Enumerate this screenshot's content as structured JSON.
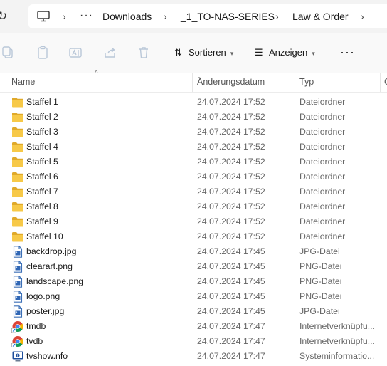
{
  "breadcrumb": {
    "items": [
      "Downloads",
      "_1_TO-NAS-SERIES",
      "Law & Order"
    ],
    "more": "···"
  },
  "toolbar": {
    "sort_label": "Sortieren",
    "view_label": "Anzeigen",
    "more": "···"
  },
  "columns": {
    "name": "Name",
    "date": "Änderungsdatum",
    "type": "Typ",
    "size": "G"
  },
  "files": [
    {
      "name": "Staffel 1",
      "date": "24.07.2024 17:52",
      "type": "Dateiordner",
      "icon": "folder-icon"
    },
    {
      "name": "Staffel 2",
      "date": "24.07.2024 17:52",
      "type": "Dateiordner",
      "icon": "folder-icon"
    },
    {
      "name": "Staffel 3",
      "date": "24.07.2024 17:52",
      "type": "Dateiordner",
      "icon": "folder-icon"
    },
    {
      "name": "Staffel 4",
      "date": "24.07.2024 17:52",
      "type": "Dateiordner",
      "icon": "folder-icon"
    },
    {
      "name": "Staffel 5",
      "date": "24.07.2024 17:52",
      "type": "Dateiordner",
      "icon": "folder-icon"
    },
    {
      "name": "Staffel 6",
      "date": "24.07.2024 17:52",
      "type": "Dateiordner",
      "icon": "folder-icon"
    },
    {
      "name": "Staffel 7",
      "date": "24.07.2024 17:52",
      "type": "Dateiordner",
      "icon": "folder-icon"
    },
    {
      "name": "Staffel 8",
      "date": "24.07.2024 17:52",
      "type": "Dateiordner",
      "icon": "folder-icon"
    },
    {
      "name": "Staffel 9",
      "date": "24.07.2024 17:52",
      "type": "Dateiordner",
      "icon": "folder-icon"
    },
    {
      "name": "Staffel 10",
      "date": "24.07.2024 17:52",
      "type": "Dateiordner",
      "icon": "folder-icon"
    },
    {
      "name": "backdrop.jpg",
      "date": "24.07.2024 17:45",
      "type": "JPG-Datei",
      "icon": "image-file-icon"
    },
    {
      "name": "clearart.png",
      "date": "24.07.2024 17:45",
      "type": "PNG-Datei",
      "icon": "image-file-icon"
    },
    {
      "name": "landscape.png",
      "date": "24.07.2024 17:45",
      "type": "PNG-Datei",
      "icon": "image-file-icon"
    },
    {
      "name": "logo.png",
      "date": "24.07.2024 17:45",
      "type": "PNG-Datei",
      "icon": "image-file-icon"
    },
    {
      "name": "poster.jpg",
      "date": "24.07.2024 17:45",
      "type": "JPG-Datei",
      "icon": "image-file-icon"
    },
    {
      "name": "tmdb",
      "date": "24.07.2024 17:47",
      "type": "Internetverknüpfu...",
      "icon": "chrome-shortcut-icon"
    },
    {
      "name": "tvdb",
      "date": "24.07.2024 17:47",
      "type": "Internetverknüpfu...",
      "icon": "chrome-shortcut-icon"
    },
    {
      "name": "tvshow.nfo",
      "date": "24.07.2024 17:47",
      "type": "Systeminformatio...",
      "icon": "system-info-icon"
    }
  ],
  "colors": {
    "folder": "#f5c33b",
    "accent": "#1a73e8",
    "header_bg": "#f3f3f3"
  }
}
